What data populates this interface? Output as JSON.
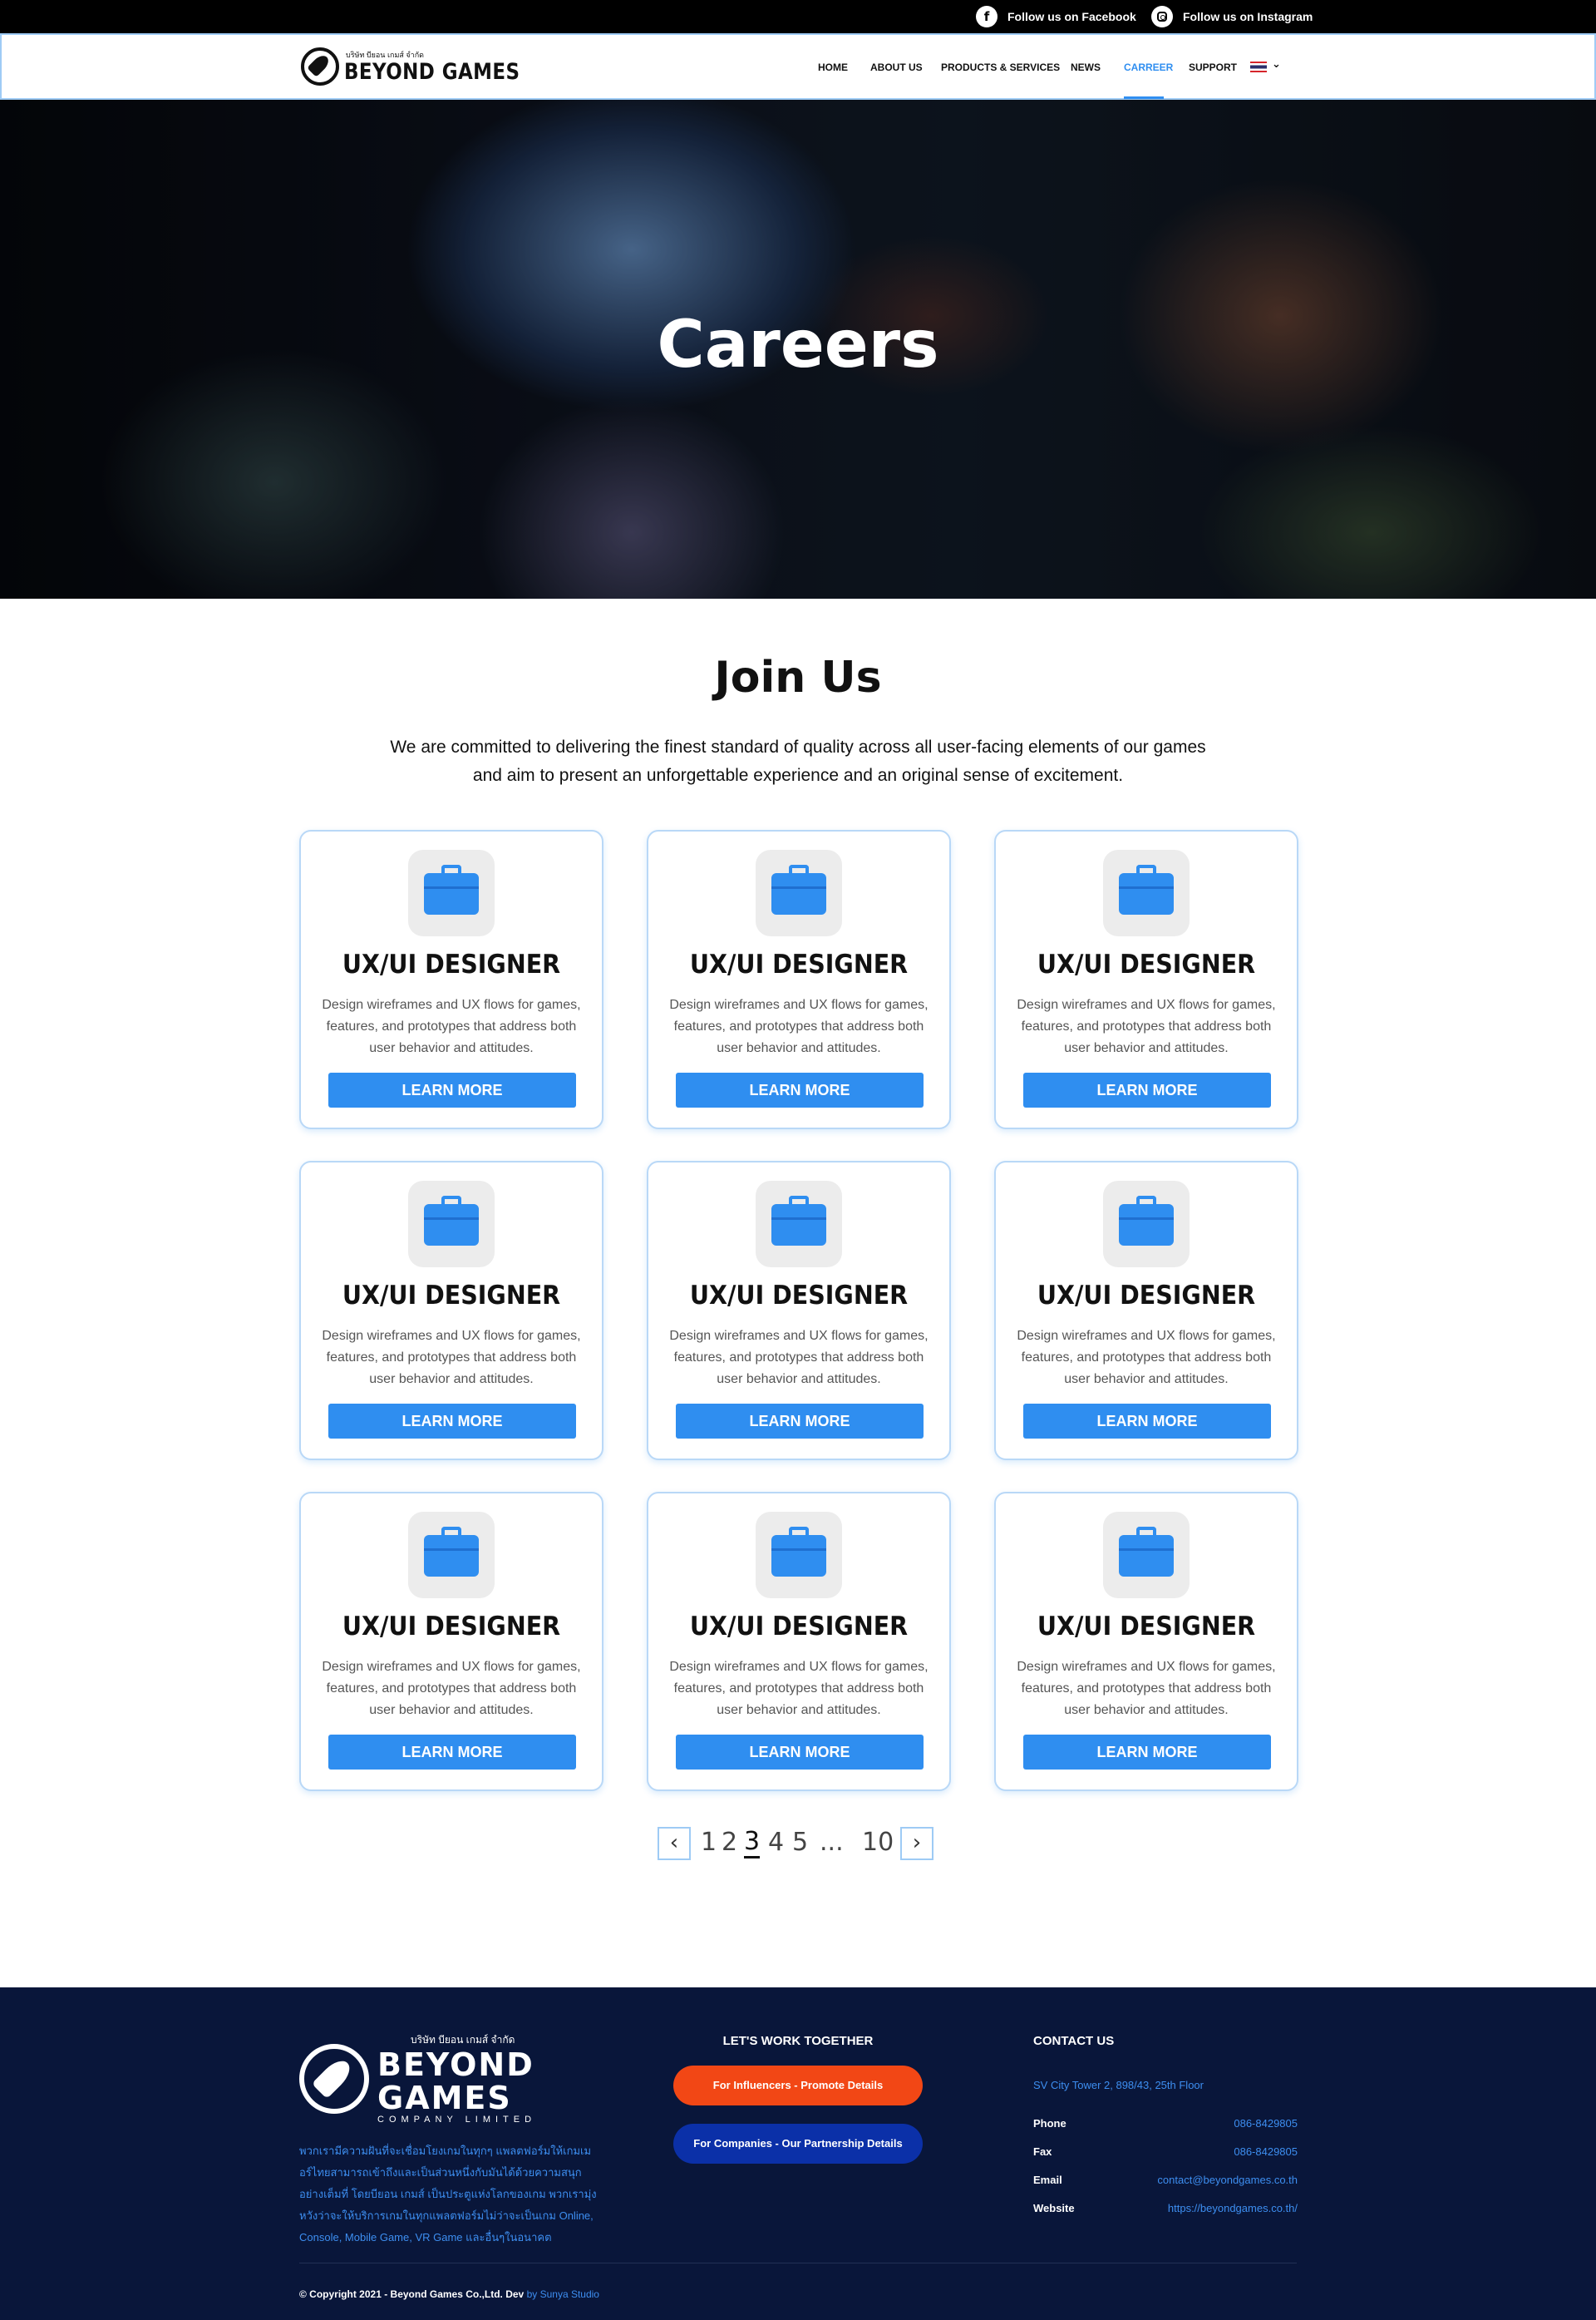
{
  "topbar": {
    "facebook": "Follow us on Facebook",
    "instagram": "Follow us on Instagram"
  },
  "header": {
    "logo_small": "บริษัท บียอน เกมส์ จำกัด",
    "logo_big": "BEYOND GAMES",
    "nav": [
      {
        "label": "HOME",
        "active": false
      },
      {
        "label": "ABOUT US",
        "active": false
      },
      {
        "label": "PRODUCTS & SERVICES",
        "active": false
      },
      {
        "label": "NEWS",
        "active": false
      },
      {
        "label": "CARREER",
        "active": true
      },
      {
        "label": "SUPPORT",
        "active": false
      }
    ],
    "language_icon": "thai-flag-icon"
  },
  "hero": {
    "title": "Careers"
  },
  "join": {
    "title": "Join Us",
    "text_line1": "We are committed to delivering the finest standard of quality across all user-facing elements of our games",
    "text_line2": "and aim to present an unforgettable experience and an original sense of excitement."
  },
  "jobs": [
    {
      "title": "UX/UI DESIGNER",
      "d1": "Design wireframes and UX flows for games,",
      "d2": "features, and prototypes that address both",
      "d3": "user behavior and attitudes.",
      "button": "LEARN MORE"
    },
    {
      "title": "UX/UI DESIGNER",
      "d1": "Design wireframes and UX flows for games,",
      "d2": "features, and prototypes that address both",
      "d3": "user behavior and attitudes.",
      "button": "LEARN MORE"
    },
    {
      "title": "UX/UI DESIGNER",
      "d1": "Design wireframes and UX flows for games,",
      "d2": "features, and prototypes that address both",
      "d3": "user behavior and attitudes.",
      "button": "LEARN MORE"
    },
    {
      "title": "UX/UI DESIGNER",
      "d1": "Design wireframes and UX flows for games,",
      "d2": "features, and prototypes that address both",
      "d3": "user behavior and attitudes.",
      "button": "LEARN MORE"
    },
    {
      "title": "UX/UI DESIGNER",
      "d1": "Design wireframes and UX flows for games,",
      "d2": "features, and prototypes that address both",
      "d3": "user behavior and attitudes.",
      "button": "LEARN MORE"
    },
    {
      "title": "UX/UI DESIGNER",
      "d1": "Design wireframes and UX flows for games,",
      "d2": "features, and prototypes that address both",
      "d3": "user behavior and attitudes.",
      "button": "LEARN MORE"
    },
    {
      "title": "UX/UI DESIGNER",
      "d1": "Design wireframes and UX flows for games,",
      "d2": "features, and prototypes that address both",
      "d3": "user behavior and attitudes.",
      "button": "LEARN MORE"
    },
    {
      "title": "UX/UI DESIGNER",
      "d1": "Design wireframes and UX flows for games,",
      "d2": "features, and prototypes that address both",
      "d3": "user behavior and attitudes.",
      "button": "LEARN MORE"
    },
    {
      "title": "UX/UI DESIGNER",
      "d1": "Design wireframes and UX flows for games,",
      "d2": "features, and prototypes that address both",
      "d3": "user behavior and attitudes.",
      "button": "LEARN MORE"
    }
  ],
  "pagination": {
    "pages": [
      "1",
      "2",
      "3",
      "4",
      "5",
      "...",
      "10"
    ],
    "current": "3",
    "prev_icon": "chevron-left-icon",
    "next_icon": "chevron-right-icon"
  },
  "footer": {
    "logo_small": "บริษัท บียอน เกมส์ จำกัด",
    "logo_big_1": "BEYOND",
    "logo_big_2": "GAMES",
    "logo_sub": "COMPANY LIMITED",
    "desc": "พวกเรามีความฝันที่จะเชื่อมโยงเกมในทุกๆ แพลตฟอร์มให้เกมเมอร์ไทยสามารถเข้าถึงและเป็นส่วนหนึ่งกับมันได้ด้วยความสนุกอย่างเต็มที่ โดยบียอน เกมส์ เป็นประตูแห่งโลกของเกม พวกเรามุ่งหวังว่าจะให้บริการเกมในทุกแพลตฟอร์มไม่ว่าจะเป็นเกม Online, Console, Mobile Game, VR Game และอื่นๆในอนาคต",
    "work_title": "LET'S WORK TOGETHER",
    "btn_influencers": "For Influencers - Promote Details",
    "btn_companies": "For Companies - Our Partnership Details",
    "contact_title": "CONTACT US",
    "address": "SV City Tower 2, 898/43, 25th Floor",
    "contacts": [
      {
        "label": "Phone",
        "value": "086-8429805"
      },
      {
        "label": "Fax",
        "value": "086-8429805"
      },
      {
        "label": "Email",
        "value": "contact@beyondgames.co.th"
      },
      {
        "label": "Website",
        "value": "https://beyondgames.co.th/"
      }
    ],
    "copyright": "© Copyright 2021 - Beyond Games Co.,Ltd. Dev",
    "copyright_by": "by Sunya Studio"
  },
  "colors": {
    "accent": "#2f8ef0",
    "footer_bg": "#09163a",
    "orange_button": "#f24715",
    "blue_button": "#0b30a8"
  }
}
